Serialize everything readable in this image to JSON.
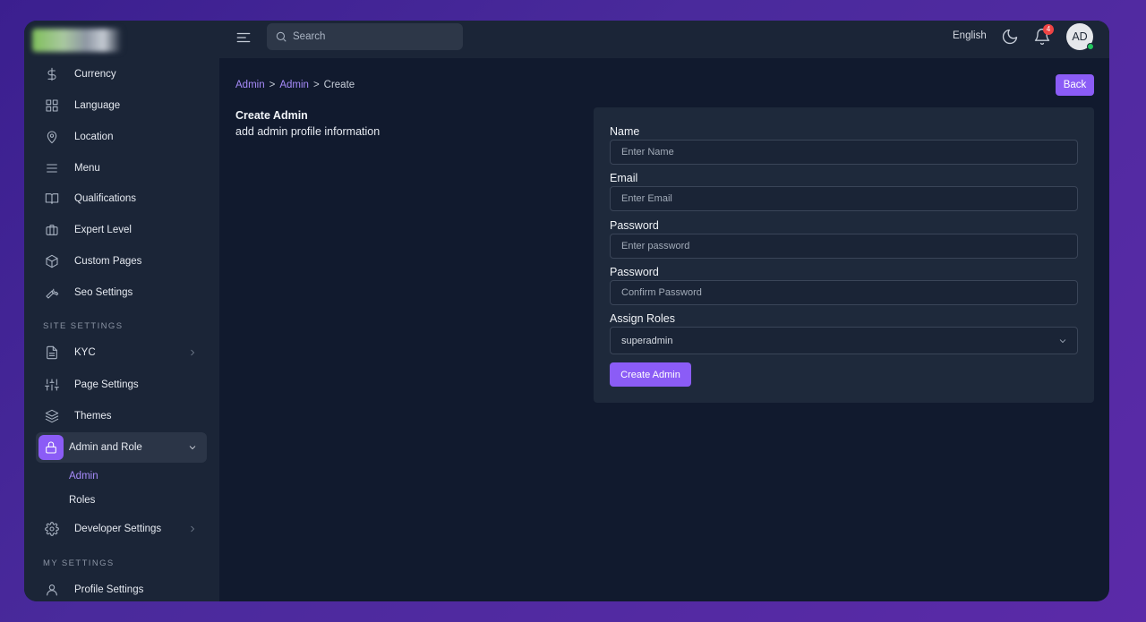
{
  "sidebar": {
    "items": [
      {
        "label": "Currency",
        "icon": "dollar-icon"
      },
      {
        "label": "Language",
        "icon": "grid-icon"
      },
      {
        "label": "Location",
        "icon": "map-pin-icon"
      },
      {
        "label": "Menu",
        "icon": "menu-lines-icon"
      },
      {
        "label": "Qualifications",
        "icon": "book-open-icon"
      },
      {
        "label": "Expert Level",
        "icon": "briefcase-icon"
      },
      {
        "label": "Custom Pages",
        "icon": "cube-icon"
      },
      {
        "label": "Seo Settings",
        "icon": "wrench-icon"
      }
    ],
    "site_settings_title": "SITE SETTINGS",
    "site_items": [
      {
        "label": "KYC",
        "icon": "document-icon"
      },
      {
        "label": "Page Settings",
        "icon": "sliders-icon"
      },
      {
        "label": "Themes",
        "icon": "layers-icon"
      },
      {
        "label": "Admin and Role",
        "icon": "lock-icon"
      },
      {
        "label": "Developer Settings",
        "icon": "gear-icon"
      }
    ],
    "sub_items": [
      "Admin",
      "Roles"
    ],
    "my_settings_title": "MY SETTINGS",
    "my_items": [
      {
        "label": "Profile Settings",
        "icon": "user-icon"
      }
    ]
  },
  "topbar": {
    "search_placeholder": "Search",
    "language": "English",
    "notification_count": "4",
    "avatar_initials": "AD"
  },
  "breadcrumb": [
    "Admin",
    ">",
    "Admin",
    ">",
    "Create"
  ],
  "back_label": "Back",
  "page": {
    "title": "Create Admin",
    "subtitle": "add admin profile information"
  },
  "form": {
    "name_label": "Name",
    "name_placeholder": "Enter Name",
    "email_label": "Email",
    "email_placeholder": "Enter Email",
    "password_label": "Password",
    "password_placeholder": "Enter password",
    "confirm_label": "Password",
    "confirm_placeholder": "Confirm Password",
    "roles_label": "Assign Roles",
    "roles_selected": "superadmin",
    "submit_label": "Create Admin"
  },
  "colors": {
    "accent": "#8b5cf6",
    "sidebar_bg": "#1b2537",
    "content_bg": "#111a2e",
    "card_bg": "#1e293b"
  }
}
